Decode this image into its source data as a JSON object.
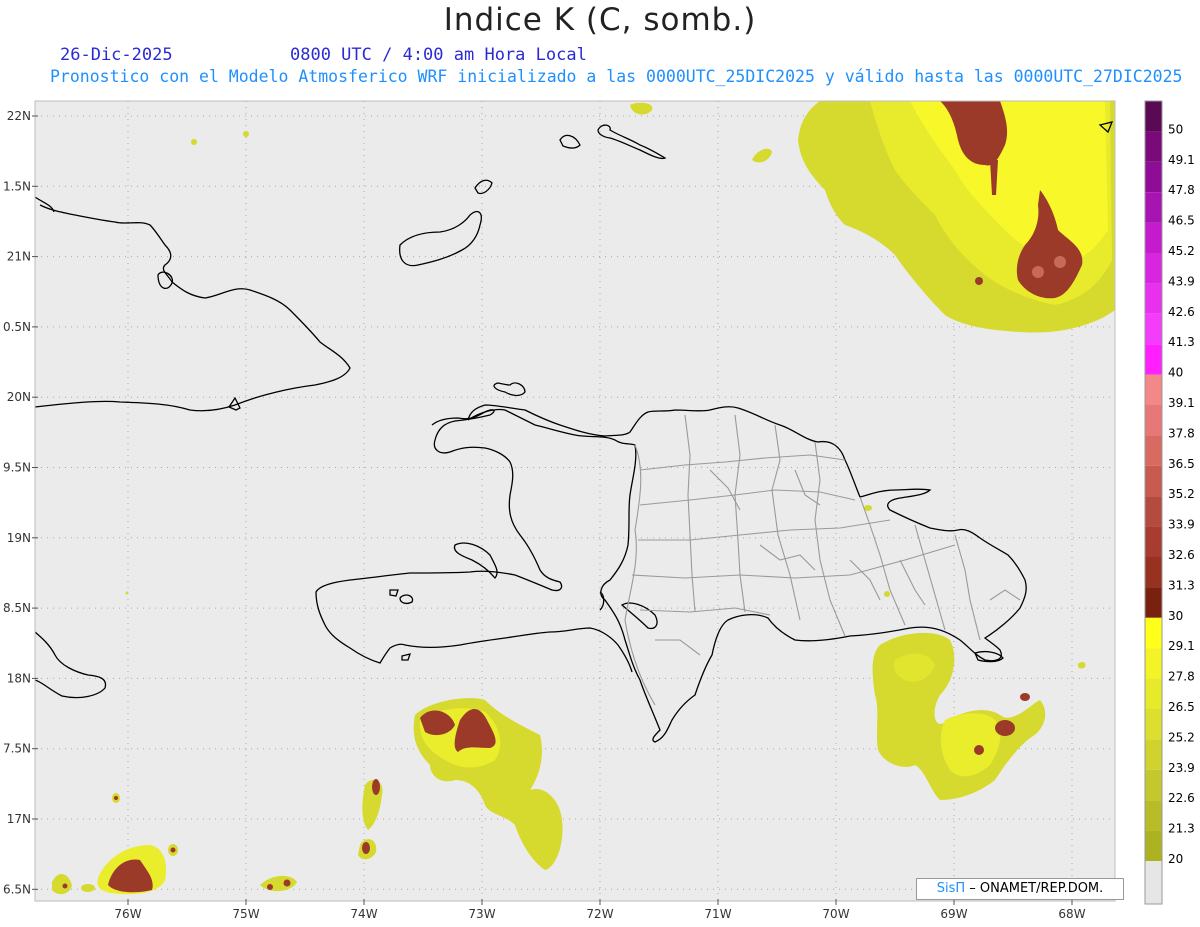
{
  "header": {
    "title": "Indice K (C, somb.)",
    "date": "26-Dic-2025",
    "time": "0800 UTC / 4:00 am Hora Local",
    "subtitle": "Pronostico con el Modelo Atmosferico WRF inicializado a las 0000UTC_25DIC2025 y válido hasta las  0000UTC_27DIC2025"
  },
  "map": {
    "lat_labels": [
      "22N",
      "1.5N",
      "21N",
      "0.5N",
      "20N",
      "9.5N",
      "19N",
      "8.5N",
      "18N",
      "7.5N",
      "17N",
      "6.5N"
    ],
    "lon_labels": [
      "76W",
      "75W",
      "74W",
      "73W",
      "72W",
      "71W",
      "70W",
      "69W",
      "68W"
    ],
    "background_color": "#ebebeb",
    "coast_color": "#000000",
    "province_color": "#9a9a9a"
  },
  "colorbar": {
    "labels": [
      "50",
      "49.1",
      "47.8",
      "46.5",
      "45.2",
      "43.9",
      "42.6",
      "41.3",
      "40",
      "39.1",
      "37.8",
      "36.5",
      "35.2",
      "33.9",
      "32.6",
      "31.3",
      "30",
      "29.1",
      "27.8",
      "26.5",
      "25.2",
      "23.9",
      "22.6",
      "21.3",
      "20"
    ],
    "colors": [
      "#5a0a55",
      "#7a0a7a",
      "#8e0c96",
      "#a814b2",
      "#c41ccc",
      "#d826e0",
      "#e830ee",
      "#f53cfa",
      "#ff1fff",
      "#f28888",
      "#e87878",
      "#d86a62",
      "#c85a50",
      "#b44a40",
      "#a83c30",
      "#983220",
      "#7a2010",
      "#ffff1a",
      "#f3f326",
      "#e6ea2b",
      "#dcdf2e",
      "#d0d32e",
      "#c4c82c",
      "#b8bc28",
      "#adb221"
    ]
  },
  "credit": {
    "brand": "SisΠ",
    "org": "– ONAMET/REP.DOM."
  }
}
